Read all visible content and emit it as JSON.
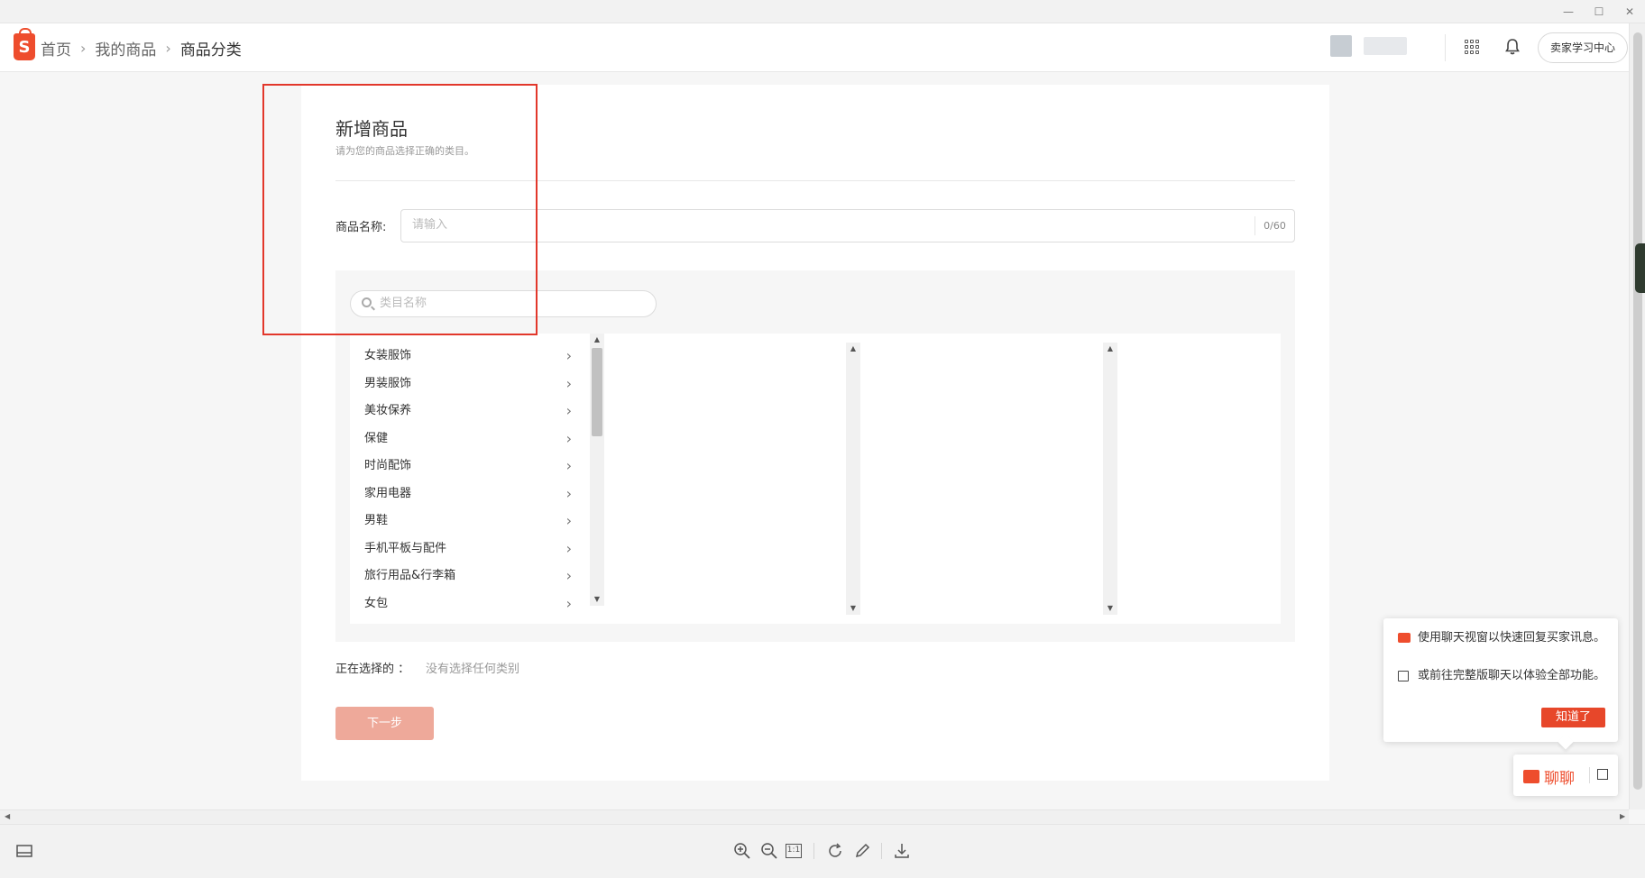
{
  "window": {
    "minimize_glyph": "—",
    "maximize_glyph": "☐",
    "close_glyph": "✕"
  },
  "header": {
    "breadcrumb": [
      "首页",
      "我的商品",
      "商品分类"
    ],
    "breadcrumb_separator": "›",
    "learn_center_label": "卖家学习中心"
  },
  "form": {
    "title": "新增商品",
    "subtitle": "请为您的商品选择正确的类目。",
    "name_label": "商品名称:",
    "name_placeholder": "请输入",
    "name_value": "",
    "name_counter": "0/60",
    "category_search_placeholder": "类目名称",
    "categories": [
      {
        "label": "女装服饰"
      },
      {
        "label": "男装服饰"
      },
      {
        "label": "美妆保养"
      },
      {
        "label": "保健"
      },
      {
        "label": "时尚配饰"
      },
      {
        "label": "家用电器"
      },
      {
        "label": "男鞋"
      },
      {
        "label": "手机平板与配件"
      },
      {
        "label": "旅行用品&行李箱"
      },
      {
        "label": "女包"
      }
    ],
    "selected_label": "正在选择的 ：",
    "selected_value": "没有选择任何类别",
    "next_button": "下一步"
  },
  "chat": {
    "tip_line1": "使用聊天视窗以快速回复买家讯息。",
    "tip_line2": "或前往完整版聊天以体验全部功能。",
    "got_it_button": "知道了",
    "chat_button": "聊聊"
  },
  "colors": {
    "brand": "#ee4d2d",
    "highlight_box": "#e2372b",
    "next_button_disabled": "#eea99a"
  },
  "toolbar_icons": [
    "zoom-in-icon",
    "zoom-out-icon",
    "actual-size-icon",
    "rotate-icon",
    "edit-icon",
    "download-icon"
  ],
  "toolbar": {
    "actual_size_glyph": "1:1"
  }
}
